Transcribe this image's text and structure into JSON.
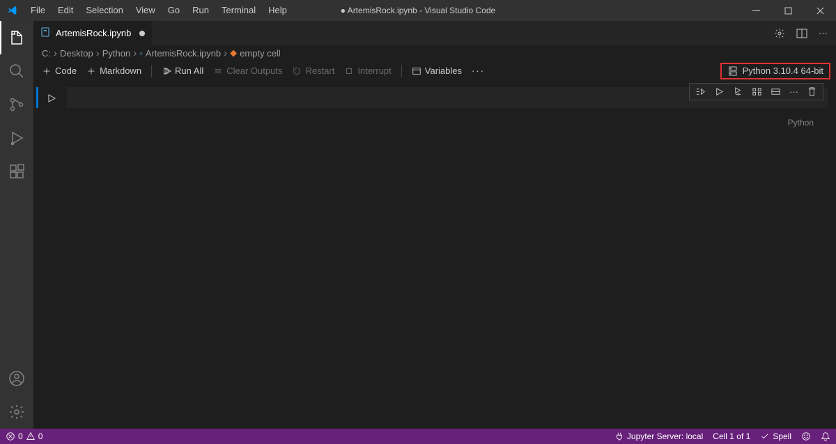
{
  "title": "● ArtemisRock.ipynb - Visual Studio Code",
  "menu": [
    "File",
    "Edit",
    "Selection",
    "View",
    "Go",
    "Run",
    "Terminal",
    "Help"
  ],
  "tab": {
    "filename": "ArtemisRock.ipynb"
  },
  "breadcrumbs": {
    "c": "C:",
    "desktop": "Desktop",
    "python": "Python",
    "file": "ArtemisRock.ipynb",
    "cell": "empty cell"
  },
  "nb_toolbar": {
    "code": "Code",
    "markdown": "Markdown",
    "run_all": "Run All",
    "clear_outputs": "Clear Outputs",
    "restart": "Restart",
    "interrupt": "Interrupt",
    "variables": "Variables"
  },
  "kernel": "Python 3.10.4 64-bit",
  "cell_lang": "Python",
  "status": {
    "errors": "0",
    "warnings": "0",
    "jupyter": "Jupyter Server: local",
    "cell": "Cell 1 of 1",
    "spell": "Spell"
  }
}
